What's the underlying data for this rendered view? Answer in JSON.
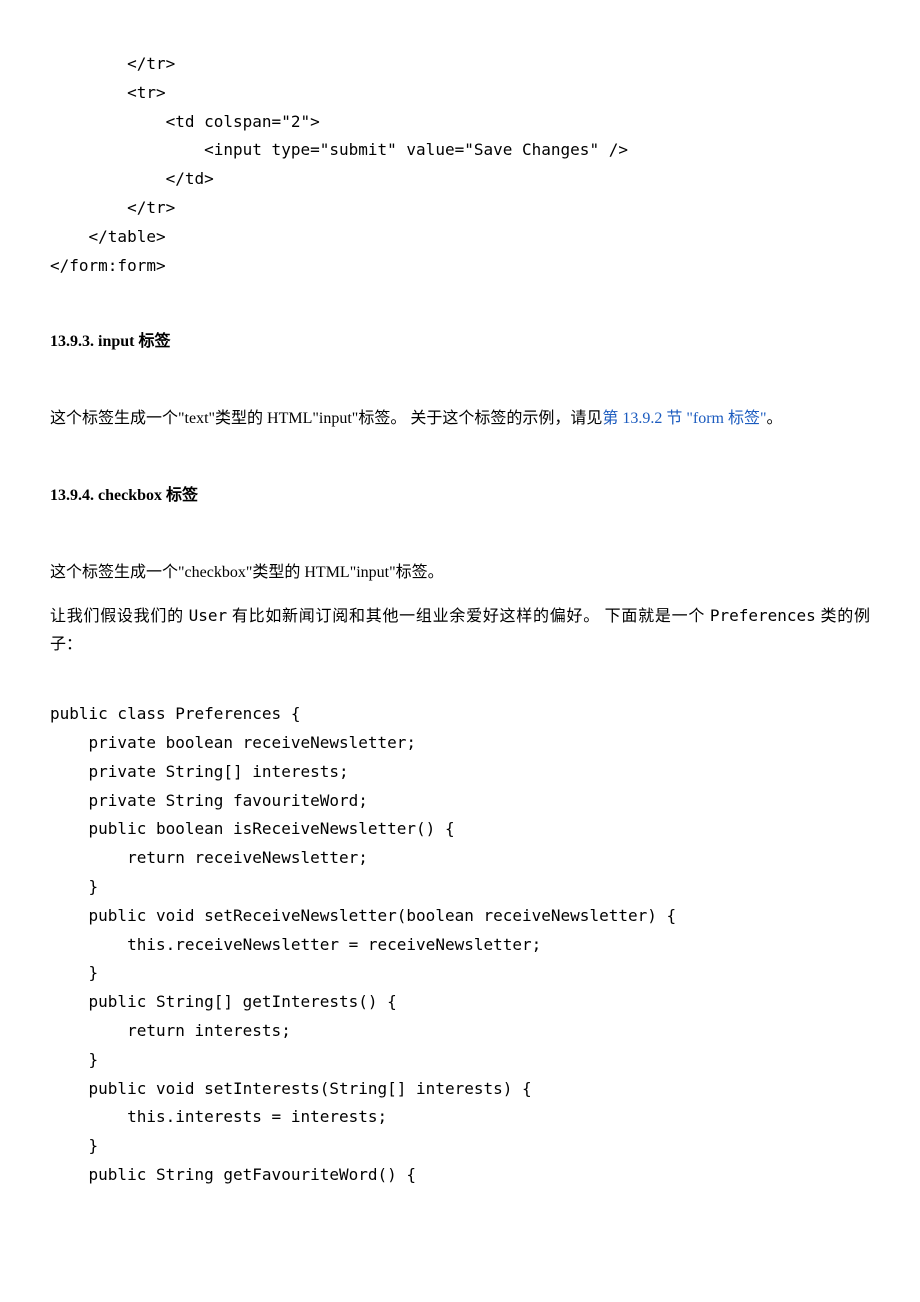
{
  "code1": "        </tr>\n        <tr>\n            <td colspan=\"2\">\n                <input type=\"submit\" value=\"Save Changes\" />\n            </td>\n        </tr>\n    </table>\n</form:form>",
  "heading1": "13.9.3. input 标签",
  "para1_a": "这个标签生成一个\"text\"类型的 HTML\"input\"标签。 关于这个标签的示例，请见",
  "para1_link": "第 13.9.2 节 \"form 标签\"",
  "para1_b": "。",
  "heading2": "13.9.4. checkbox 标签",
  "para2": "这个标签生成一个\"checkbox\"类型的 HTML\"input\"标签。",
  "para3_a": "让我们假设我们的 ",
  "para3_user": "User",
  "para3_b": " 有比如新闻订阅和其他一组业余爱好这样的偏好。 下面就是一个 ",
  "para3_pref": "Preferences",
  "para3_c": " 类的例子：",
  "code2": "public class Preferences {\n    private boolean receiveNewsletter;\n    private String[] interests;\n    private String favouriteWord;\n    public boolean isReceiveNewsletter() {\n        return receiveNewsletter;\n    }\n    public void setReceiveNewsletter(boolean receiveNewsletter) {\n        this.receiveNewsletter = receiveNewsletter;\n    }\n    public String[] getInterests() {\n        return interests;\n    }\n    public void setInterests(String[] interests) {\n        this.interests = interests;\n    }\n    public String getFavouriteWord() {"
}
